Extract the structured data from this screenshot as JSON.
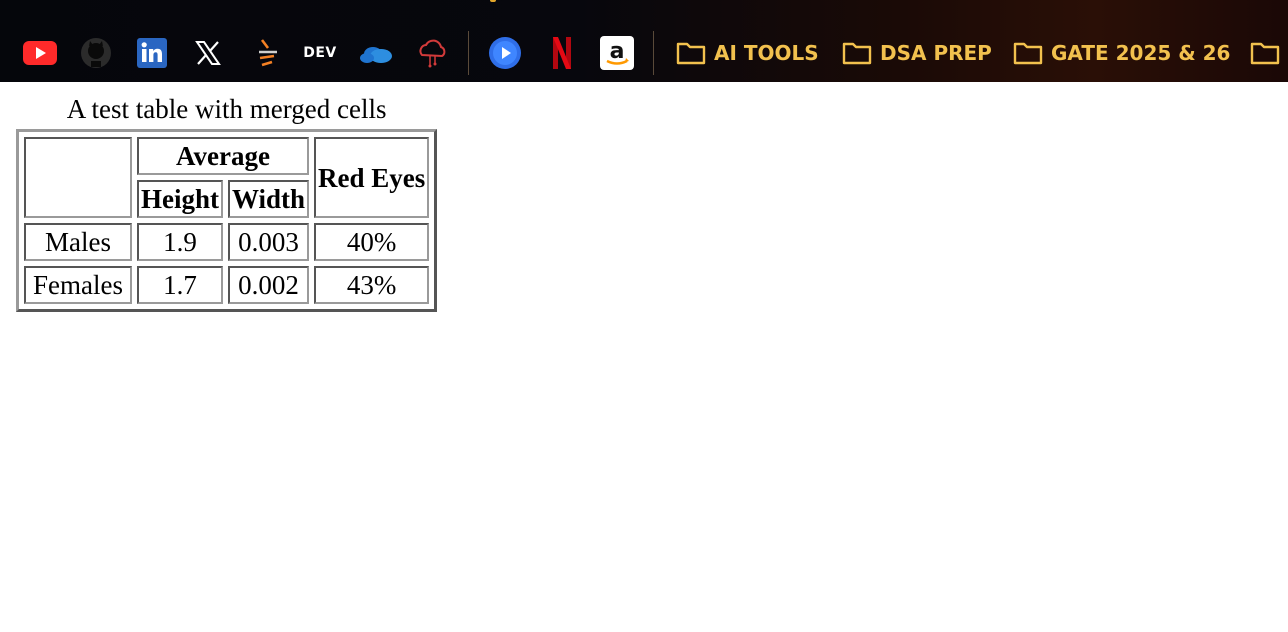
{
  "bookmarks_bar": {
    "icons": [
      {
        "name": "youtube-icon",
        "color": "#ff2a2a"
      },
      {
        "name": "github-icon",
        "color": "#2b2b2b"
      },
      {
        "name": "linkedin-icon",
        "color": "#2a66c2"
      },
      {
        "name": "x-icon",
        "color": "#ffffff"
      },
      {
        "name": "stack-overflow-icon",
        "color": "#f48024"
      },
      {
        "name": "dev-icon",
        "label": "DEV"
      },
      {
        "name": "onedrive-icon",
        "color": "#2d8ee0"
      },
      {
        "name": "cloud-circuit-icon",
        "color": "#d23a3a"
      },
      {
        "name": "play-icon",
        "color": "#2f6ee8"
      },
      {
        "name": "netflix-icon",
        "color": "#e50914"
      },
      {
        "name": "amazon-icon",
        "color": "#ffffff"
      }
    ],
    "folders": [
      {
        "label": "AI TOOLS"
      },
      {
        "label": "DSA PREP"
      },
      {
        "label": "GATE 2025 & 26"
      },
      {
        "label": ""
      }
    ],
    "folder_color": "#f2c14e"
  },
  "table": {
    "caption": "A test table with merged cells",
    "header": {
      "average": "Average",
      "height": "Height",
      "width": "Width",
      "red_eyes": "Red Eyes"
    },
    "rows": [
      {
        "label": "Males",
        "height": "1.9",
        "width": "0.003",
        "red_eyes": "40%"
      },
      {
        "label": "Females",
        "height": "1.7",
        "width": "0.002",
        "red_eyes": "43%"
      }
    ]
  }
}
